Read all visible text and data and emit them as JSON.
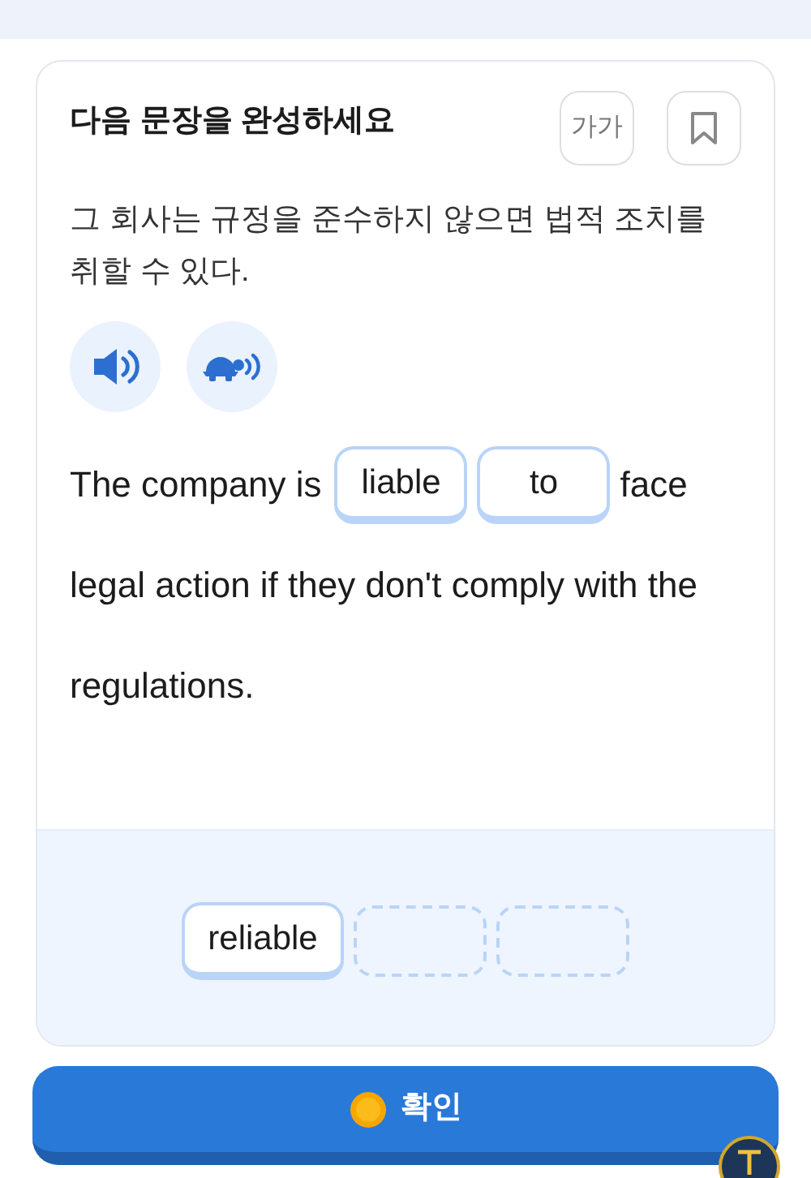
{
  "title": "다음 문장을 완성하세요",
  "font_size_button": "가가",
  "bookmark": {
    "selected": false
  },
  "prompt": "그 회사는 규정을 준수하지 않으면 법적 조치를 취할 수 있다.",
  "sentence": [
    {
      "kind": "text",
      "text": "The company is"
    },
    {
      "kind": "blank",
      "text": "liable"
    },
    {
      "kind": "blank",
      "text": "to"
    },
    {
      "kind": "text",
      "text": "face"
    },
    {
      "kind": "text",
      "text": "legal action if they don't comply with the"
    },
    {
      "kind": "text",
      "text": "regulations."
    }
  ],
  "word_bank": [
    {
      "text": "reliable",
      "used": false
    },
    {
      "used": true
    },
    {
      "used": true
    }
  ],
  "confirm_button": "확인"
}
